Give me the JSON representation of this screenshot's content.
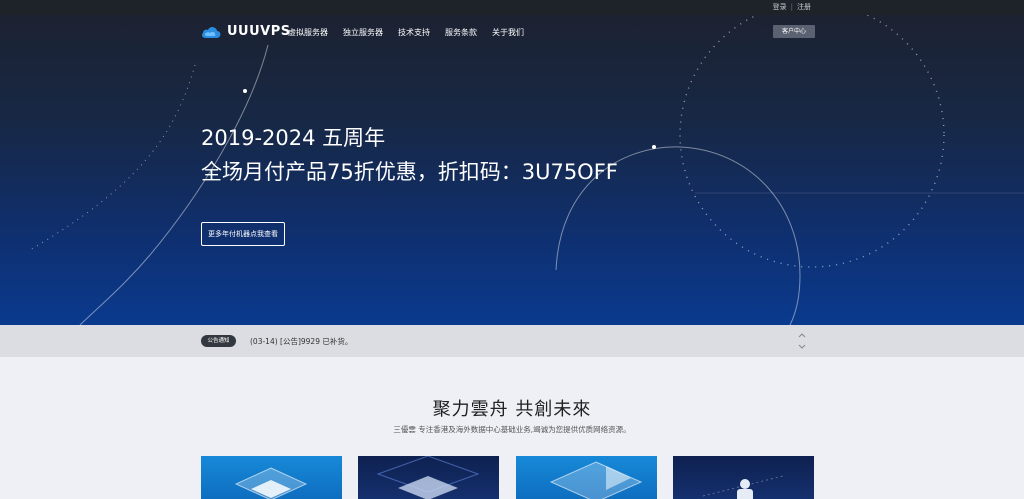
{
  "topbar": {
    "login": "登录",
    "register": "注册"
  },
  "nav": {
    "brand": "UUUVPS",
    "menu": [
      "虚拟服务器",
      "独立服务器",
      "技术支持",
      "服务条款",
      "关于我们"
    ],
    "client_center": "客户中心"
  },
  "hero": {
    "line1": "2019-2024 五周年",
    "line2": "全场月付产品75折优惠，折扣码：3U75OFF",
    "cta": "更多年付机器点我查看"
  },
  "notice": {
    "badge": "公告通知",
    "text": "(03-14) [公告]9929 已补货。"
  },
  "section": {
    "title": "聚力雲舟 共創未來",
    "subtitle": "三優雲 专注香港及海外数据中心基础业务,竭诚为您提供优质网络资源。"
  },
  "colors": {
    "brand_blue": "#0a3a8e",
    "card_blue": "#1789d8",
    "card_navy": "#0e2150"
  }
}
